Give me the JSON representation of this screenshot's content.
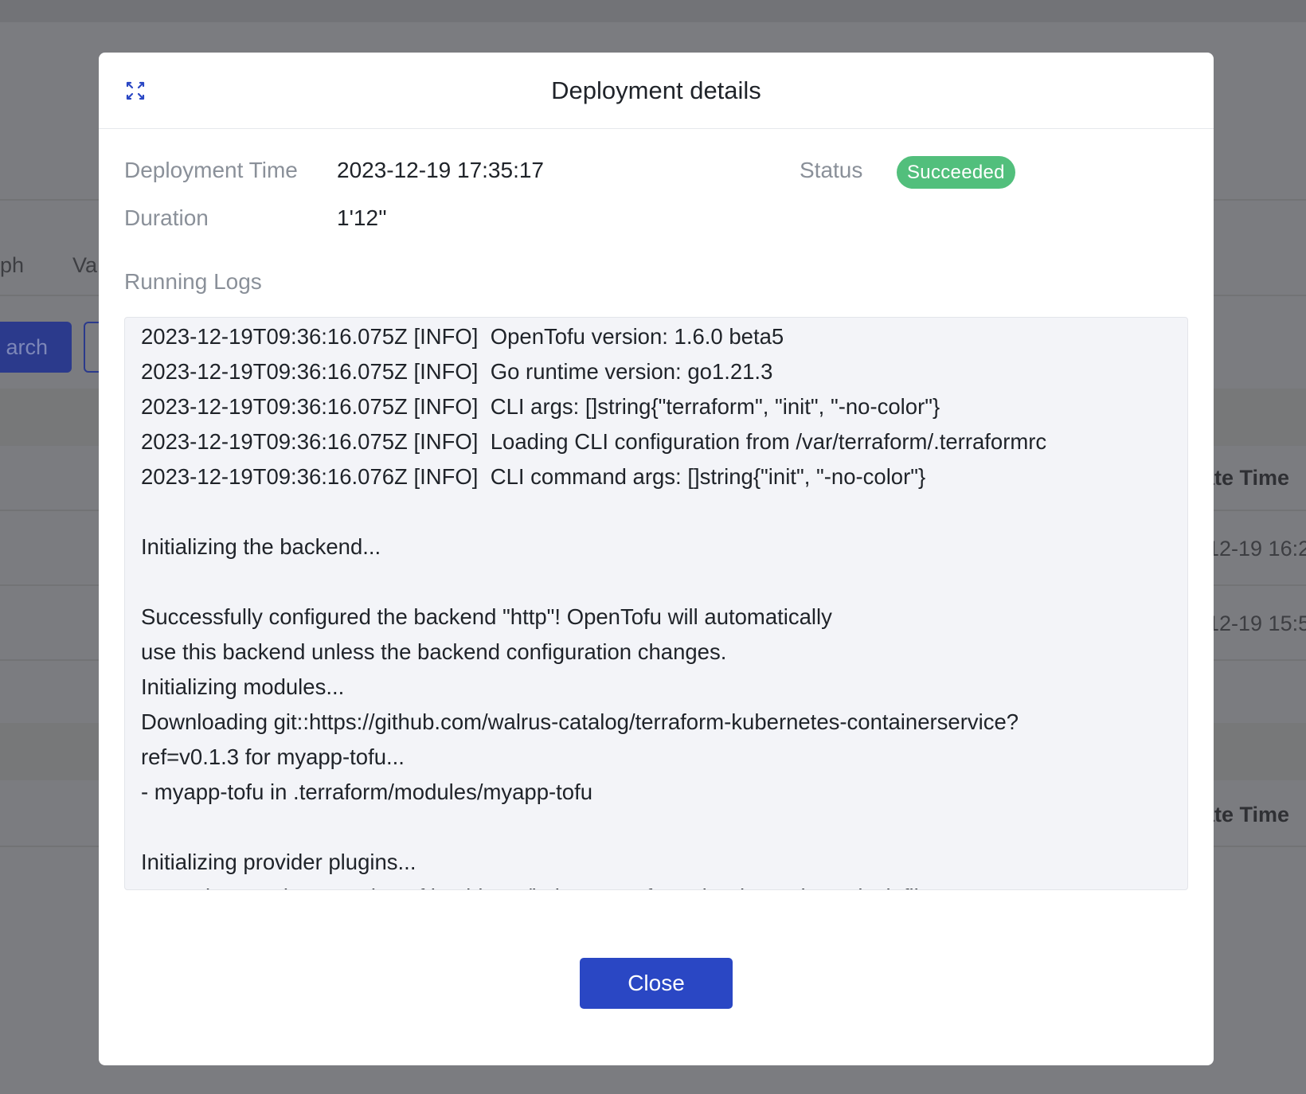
{
  "background": {
    "tabs": [
      "ph",
      "Va"
    ],
    "search_button": "arch",
    "column_header_1": "ate Time",
    "row_1_time": "12-19 16:2",
    "row_2_time": "12-19 15:5",
    "column_header_2": "ate Time"
  },
  "modal": {
    "title": "Deployment details",
    "expand_icon": "expand-arrows-icon",
    "deployment_time_label": "Deployment Time",
    "deployment_time_value": "2023-12-19 17:35:17",
    "status_label": "Status",
    "status_value": "Succeeded",
    "duration_label": "Duration",
    "duration_value": "1'12''",
    "logs_label": "Running Logs",
    "logs": [
      "2023-12-19T09:36:16.075Z [INFO]  OpenTofu version: 1.6.0 beta5",
      "2023-12-19T09:36:16.075Z [INFO]  Go runtime version: go1.21.3",
      "2023-12-19T09:36:16.075Z [INFO]  CLI args: []string{\"terraform\", \"init\", \"-no-color\"}",
      "2023-12-19T09:36:16.075Z [INFO]  Loading CLI configuration from /var/terraform/.terraformrc",
      "2023-12-19T09:36:16.076Z [INFO]  CLI command args: []string{\"init\", \"-no-color\"}",
      "",
      "Initializing the backend...",
      "",
      "Successfully configured the backend \"http\"! OpenTofu will automatically",
      "use this backend unless the backend configuration changes.",
      "Initializing modules...",
      "Downloading git::https://github.com/walrus-catalog/terraform-kubernetes-containerservice?",
      "ref=v0.1.3 for myapp-tofu...",
      "- myapp-tofu in .terraform/modules/myapp-tofu",
      "",
      "Initializing provider plugins...",
      "- Reusing previous version of hashicorp/kubernetes from the dependency lock file"
    ],
    "close_label": "Close"
  },
  "colors": {
    "primary": "#2a47c4",
    "success": "#52bf7c",
    "overlay": "#7b7c80"
  }
}
